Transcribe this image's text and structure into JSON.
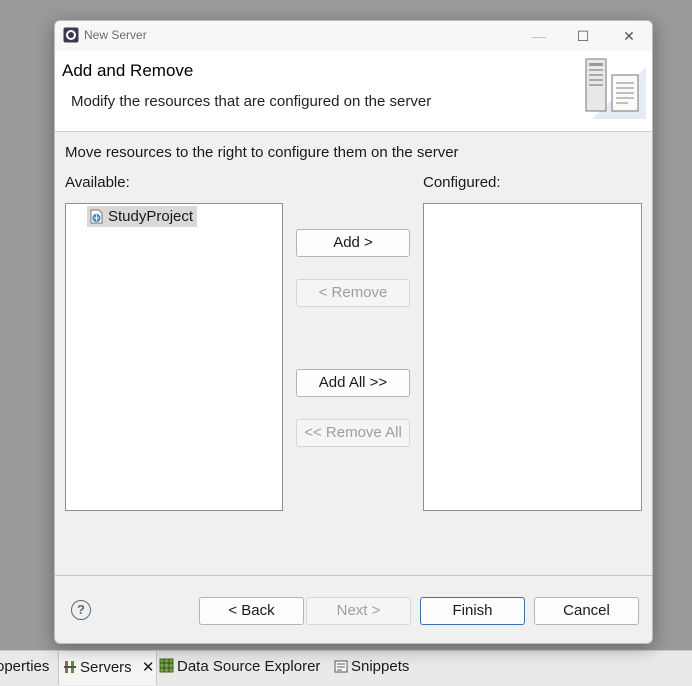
{
  "dialog": {
    "title": "New Server",
    "window_controls": {
      "minimize": "—",
      "maximize": "☐",
      "close": "✕"
    }
  },
  "banner": {
    "title": "Add and Remove",
    "description": "Modify the resources that are configured on the server"
  },
  "instructions": "Move resources to the right to configure them on the server",
  "available": {
    "label": "Available:",
    "items": [
      {
        "label": "StudyProject",
        "icon": "web-project-icon",
        "selected": true
      }
    ]
  },
  "configured": {
    "label": "Configured:",
    "items": []
  },
  "buttons": {
    "add": "Add >",
    "remove": "< Remove",
    "add_all": "Add All >>",
    "remove_all": "<< Remove All",
    "back": "< Back",
    "next": "Next >",
    "finish": "Finish",
    "cancel": "Cancel"
  },
  "ide_tabs": [
    {
      "label": "operties",
      "icon": "properties-icon"
    },
    {
      "label": "Servers",
      "icon": "servers-icon",
      "active": true,
      "closable": true
    },
    {
      "label": "Data Source Explorer",
      "icon": "data-source-icon"
    },
    {
      "label": "Snippets",
      "icon": "snippets-icon"
    }
  ],
  "colors": {
    "default_button_border": "#3a6fb0",
    "selection": "#d9d9d9"
  }
}
